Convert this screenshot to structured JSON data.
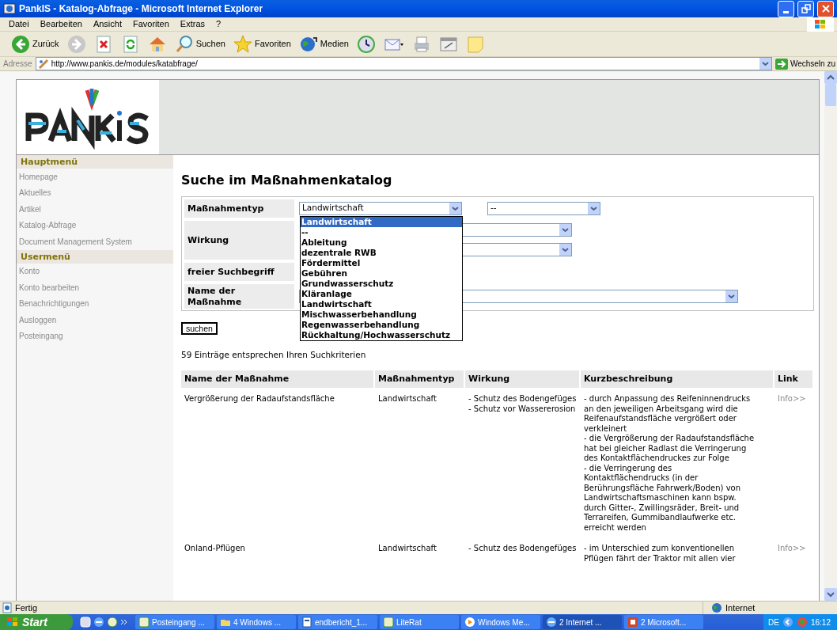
{
  "window": {
    "title": "PankIS - Katalog-Abfrage - Microsoft Internet Explorer"
  },
  "menu": [
    "Datei",
    "Bearbeiten",
    "Ansicht",
    "Favoriten",
    "Extras",
    "?"
  ],
  "toolbar": [
    {
      "kind": "back",
      "label": "Zurück"
    },
    {
      "kind": "forward"
    },
    {
      "kind": "stop"
    },
    {
      "kind": "refresh"
    },
    {
      "kind": "home"
    },
    {
      "kind": "search",
      "label": "Suchen"
    },
    {
      "kind": "favorites",
      "label": "Favoriten"
    },
    {
      "kind": "media",
      "label": "Medien"
    },
    {
      "kind": "history"
    },
    {
      "kind": "mail"
    },
    {
      "kind": "print"
    },
    {
      "kind": "edit"
    },
    {
      "kind": "note"
    }
  ],
  "address": {
    "label": "Adresse",
    "value": "http://www.pankis.de/modules/katabfrage/",
    "go": "Wechseln zu"
  },
  "sidebar": [
    {
      "heading": "Hauptmenü",
      "items": [
        "Homepage",
        "Aktuelles",
        "Artikel",
        "Katalog-Abfrage",
        "Document Management System"
      ]
    },
    {
      "heading": "Usermenü",
      "items": [
        "Konto",
        "Konto bearbeiten",
        "Benachrichtigungen",
        "Ausloggen",
        "Posteingang"
      ]
    }
  ],
  "heading": "Suche im Maßnahmenkatalog",
  "form": {
    "type_label": "Maßnahmentyp",
    "type_value": "Landwirtschaft",
    "subtype_value": "--",
    "effect_label": "Wirkung",
    "term_label": "freier Suchbegriff",
    "name_label": "Name der Maßnahme",
    "dropdown": [
      {
        "label": "Landwirtschaft",
        "selected": true
      },
      {
        "label": "--",
        "selected": false
      },
      {
        "label": "Ableitung",
        "selected": false
      },
      {
        "label": "dezentrale RWB",
        "selected": false
      },
      {
        "label": "Fördermittel",
        "selected": false
      },
      {
        "label": "Gebühren",
        "selected": false
      },
      {
        "label": "Grundwasserschutz",
        "selected": false
      },
      {
        "label": "Kläranlage",
        "selected": false
      },
      {
        "label": "Landwirtschaft",
        "selected": false
      },
      {
        "label": "Mischwasserbehandlung",
        "selected": false
      },
      {
        "label": "Regenwasserbehandlung",
        "selected": false
      },
      {
        "label": "Rückhaltung/Hochwasserschutz",
        "selected": false
      }
    ],
    "submit": "suchen"
  },
  "result_count": "59 Einträge entsprechen Ihren Suchkriterien",
  "table": {
    "columns": [
      "Name der Maßnahme",
      "Maßnahmentyp",
      "Wirkung",
      "Kurzbeschreibung",
      "Link"
    ],
    "rows": [
      {
        "name": "Vergrößerung der Radaufstandsfläche",
        "type": "Landwirtschaft",
        "effects": [
          "- Schutz des Bodengefüges",
          "- Schutz vor Wassererosion"
        ],
        "description": [
          "- durch Anpassung des Reifeninnendrucks an den jeweiligen Arbeitsgang wird die Reifenaufstandsfläche vergrößert oder verkleinert",
          "- die Vergrößerung der Radaufstandsfläche hat bei gleicher Radlast die Verringerung des Kontaktflächendruckes zur Folge",
          "- die Verringerung des Kontaktflächendrucks (in der Berührungsfläche Fahrwerk/Boden) von Landwirtschaftsmaschinen kann bspw. durch Gitter-, Zwillingsräder, Breit- und Terrareifen, Gummibandlaufwerke etc. erreicht werden"
        ],
        "link": "Info>>"
      },
      {
        "name": "Onland-Pflügen",
        "type": "Landwirtschaft",
        "effects": [
          "- Schutz des Bodengefüges"
        ],
        "description": [
          "- im Unterschied zum konventionellen Pflügen fährt der Traktor mit allen vier"
        ],
        "link": "Info>>"
      }
    ]
  },
  "status_bar": {
    "text": "Fertig",
    "zone": "Internet"
  },
  "taskbar": {
    "start": "Start",
    "tasks": [
      {
        "label": "Posteingang ...",
        "selected": false,
        "kind": "app"
      },
      {
        "label": "4 Windows ...",
        "selected": false,
        "kind": "folder"
      },
      {
        "label": "endbericht_1...",
        "selected": false,
        "kind": "doc"
      },
      {
        "label": "LiteRat",
        "selected": false,
        "kind": "app"
      },
      {
        "label": "Windows Me...",
        "selected": false,
        "kind": "media"
      },
      {
        "label": "2 Internet ...",
        "selected": true,
        "kind": "ie"
      },
      {
        "label": "2 Microsoft...",
        "selected": false,
        "kind": "ppt"
      }
    ],
    "language": "DE",
    "clock": "16:12"
  }
}
